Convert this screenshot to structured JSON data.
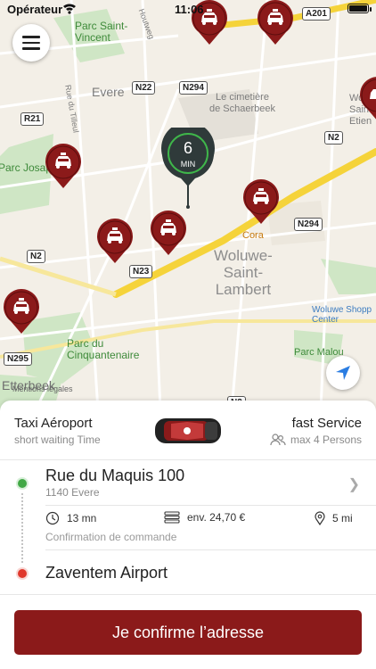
{
  "status_bar": {
    "carrier": "Opérateur",
    "time": "11:06"
  },
  "map": {
    "places": {
      "parc_saint_vincent": "Parc Saint-\nVincent",
      "evere": "Evere",
      "rue_du_tilleul": "Rue du Tilleul",
      "cimetiere": "Le cimetière\nde Schaerbeek",
      "woluwe": "Woluwe-\nSaint-\nLambert",
      "cora": "Cora",
      "parc_josaphat": "Parc Josaph",
      "parc_cinquantenaire": "Parc du\nCinquantenaire",
      "woluwe_shopping": "Woluwe Shopp\nCenter",
      "parc_malou": "Parc Malou",
      "etterbeek": "Etterbeek",
      "saint_etienne": "Woluwe\nSaint-\nEtien",
      "mentions": "Mentions légales",
      "houtweg": "Houtweg"
    },
    "roads": [
      "A201",
      "N22",
      "N294",
      "R21",
      "N2",
      "N23",
      "N294",
      "N2",
      "N295",
      "N2"
    ],
    "eta": {
      "value": "6",
      "unit": "MIN"
    },
    "colors": {
      "pin": "#8b1a1a",
      "eta_ring": "#3fb64a",
      "highway": "#f5d33a"
    }
  },
  "service": {
    "name": "Taxi Aéroport",
    "subtitle": "short waiting Time",
    "type": "fast Service",
    "capacity": "max 4 Persons"
  },
  "route": {
    "pickup": {
      "address": "Rue du Maquis 100",
      "city": "1140 Evere"
    },
    "stats": {
      "duration": "13 mn",
      "price": "env. 24,70 €",
      "distance": "5 mi"
    },
    "confirmation_label": "Confirmation de commande",
    "destination": "Zaventem Airport"
  },
  "confirm_button": {
    "label": "Je confirme l’adresse",
    "color": "#8b1a1a"
  }
}
